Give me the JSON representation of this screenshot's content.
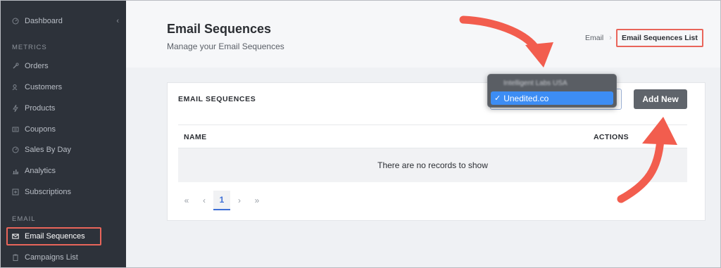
{
  "sidebar": {
    "items": [
      {
        "label": "Dashboard",
        "icon": "gauge-icon"
      },
      {
        "label": "Orders",
        "icon": "wrench-icon"
      },
      {
        "label": "Customers",
        "icon": "users-icon"
      },
      {
        "label": "Products",
        "icon": "bolt-icon"
      },
      {
        "label": "Coupons",
        "icon": "ticket-icon"
      },
      {
        "label": "Sales By Day",
        "icon": "gauge-icon"
      },
      {
        "label": "Analytics",
        "icon": "bar-chart-icon"
      },
      {
        "label": "Subscriptions",
        "icon": "plus-square-icon"
      },
      {
        "label": "Email Sequences",
        "icon": "envelope-icon"
      },
      {
        "label": "Campaigns List",
        "icon": "clipboard-icon"
      }
    ],
    "sections": {
      "metrics": "METRICS",
      "email": "EMAIL"
    },
    "collapse_glyph": "‹"
  },
  "header": {
    "title": "Email Sequences",
    "subtitle": "Manage your Email Sequences",
    "breadcrumb": {
      "parent": "Email",
      "separator": "›",
      "current": "Email Sequences List"
    }
  },
  "card": {
    "title": "EMAIL SEQUENCES",
    "add_button": "Add New",
    "columns": {
      "name": "NAME",
      "actions": "ACTIONS"
    },
    "empty_message": "There are no records to show",
    "pagination": {
      "first": "«",
      "prev": "‹",
      "current": "1",
      "next": "›",
      "last": "»"
    }
  },
  "dropdown": {
    "options": [
      "Intelligent Labs USA",
      "Unedited.co"
    ],
    "selected": "Unedited.co",
    "check": "✓"
  },
  "colors": {
    "sidebar_bg": "#2d323a",
    "highlight": "#e9655a",
    "arrow": "#f25d4e",
    "selected_option": "#3d8df4",
    "button": "#5f646b"
  }
}
